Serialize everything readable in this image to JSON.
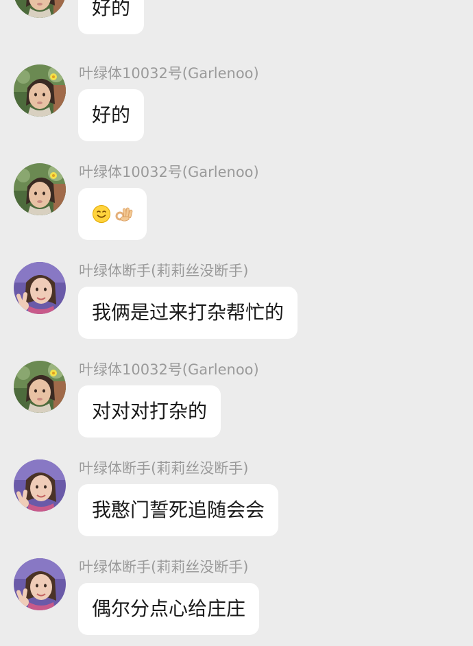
{
  "messages": [
    {
      "sender": "",
      "text": "好的",
      "avatar": "girl-flower"
    },
    {
      "sender": "叶绿体10032号(Garlenoo)",
      "text": "好的",
      "avatar": "girl-flower"
    },
    {
      "sender": "叶绿体10032号(Garlenoo)",
      "emojis": [
        "smile-emoji",
        "ok-hand-emoji"
      ],
      "avatar": "girl-flower"
    },
    {
      "sender": "叶绿体断手(莉莉丝没断手)",
      "text": "我俩是过来打杂帮忙的",
      "avatar": "girl-peace"
    },
    {
      "sender": "叶绿体10032号(Garlenoo)",
      "text": "对对对打杂的",
      "avatar": "girl-flower"
    },
    {
      "sender": "叶绿体断手(莉莉丝没断手)",
      "text": "我憨门誓死追随会会",
      "avatar": "girl-peace"
    },
    {
      "sender": "叶绿体断手(莉莉丝没断手)",
      "text": "偶尔分点心给庄庄",
      "avatar": "girl-peace"
    }
  ],
  "colors": {
    "background": "#ececec",
    "bubble": "#ffffff",
    "sender_text": "#9a9a9a",
    "message_text": "#1a1a1a"
  }
}
